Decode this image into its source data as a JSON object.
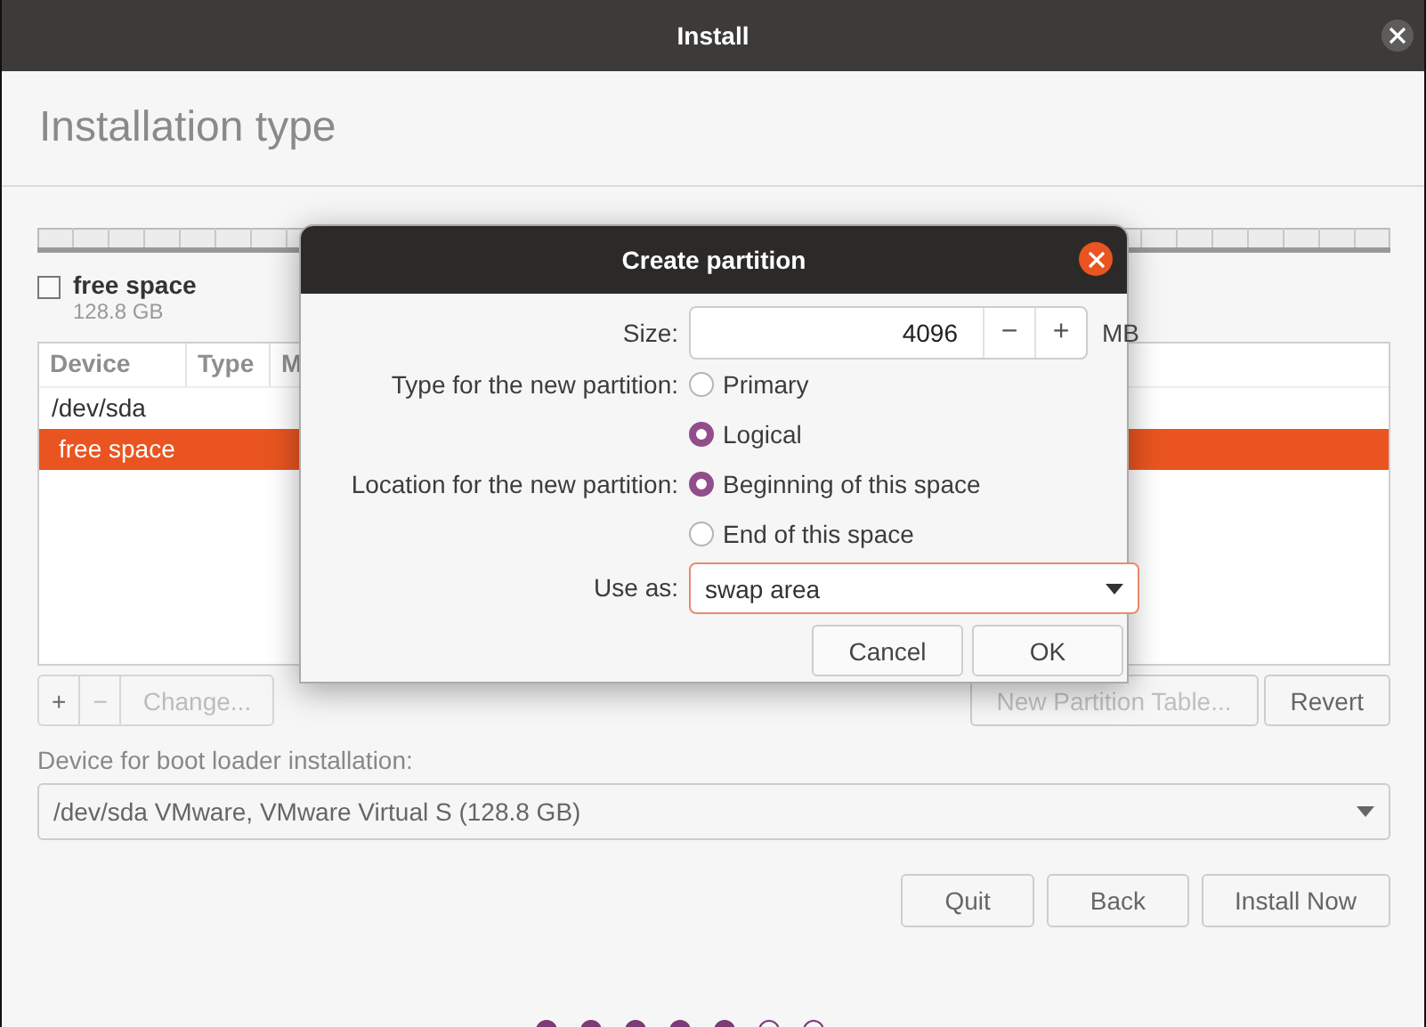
{
  "window": {
    "title": "Install"
  },
  "page_title": "Installation type",
  "legend": {
    "label": "free space",
    "size": "128.8 GB",
    "checked": false
  },
  "table": {
    "columns": [
      "Device",
      "Type",
      "M"
    ],
    "rows": [
      {
        "device": "/dev/sda",
        "selected": false,
        "children": [
          {
            "device": "free space",
            "selected": true
          }
        ]
      }
    ]
  },
  "partition_buttons": [
    {
      "label": "+",
      "disabled": false
    },
    {
      "label": "−",
      "disabled": true
    },
    {
      "label": "Change...",
      "disabled": true
    }
  ],
  "table_buttons": [
    {
      "label": "New Partition Table...",
      "disabled": true
    },
    {
      "label": "Revert",
      "disabled": false
    }
  ],
  "boot_loader": {
    "label": "Device for boot loader installation:",
    "value": "/dev/sda VMware, VMware Virtual S (128.8 GB)"
  },
  "buttons": [
    {
      "label": "Quit"
    },
    {
      "label": "Back"
    },
    {
      "label": "Install Now"
    }
  ],
  "steps": [
    {
      "done": true
    },
    {
      "done": true
    },
    {
      "done": true
    },
    {
      "done": true
    },
    {
      "done": true
    },
    {
      "done": false
    },
    {
      "done": false
    }
  ],
  "dialog": {
    "title": "Create partition",
    "size": {
      "label": "Size:",
      "value": "4096",
      "minus": "−",
      "plus": "+",
      "unit": "MB"
    },
    "groups": [
      {
        "label": "Type for the new partition:",
        "options": [
          {
            "label": "Primary",
            "selected": false
          },
          {
            "label": "Logical",
            "selected": true
          }
        ]
      },
      {
        "label": "Location for the new partition:",
        "options": [
          {
            "label": "Beginning of this space",
            "selected": true
          },
          {
            "label": "End of this space",
            "selected": false
          }
        ]
      }
    ],
    "use_as": {
      "label": "Use as:",
      "value": "swap area"
    },
    "buttons": [
      {
        "label": "Cancel"
      },
      {
        "label": "OK"
      }
    ]
  }
}
